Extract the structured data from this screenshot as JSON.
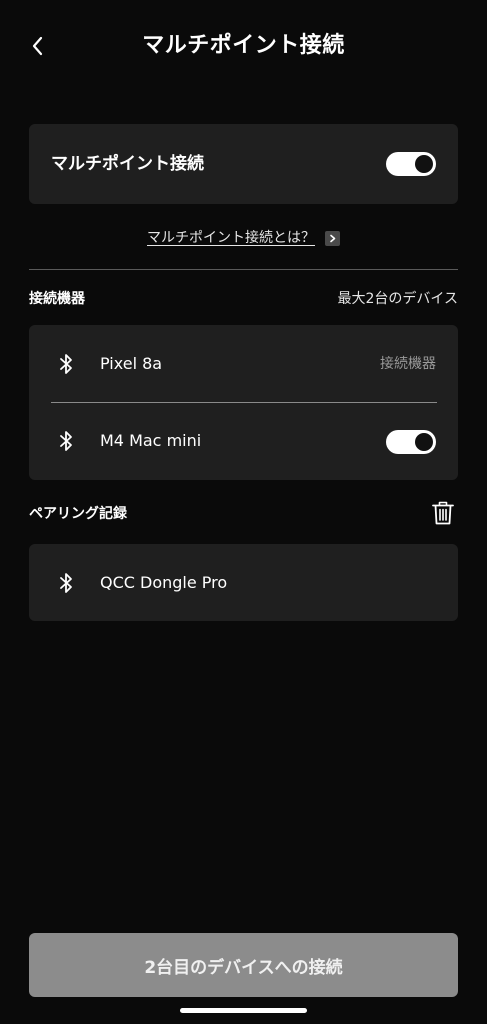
{
  "header": {
    "title": "マルチポイント接続",
    "back_icon": "chevron-left-icon"
  },
  "multipoint": {
    "label": "マルチポイント接続",
    "enabled": true
  },
  "help": {
    "link_text": "マルチポイント接続とは？",
    "arrow_icon": "chevron-right-icon"
  },
  "connected": {
    "title": "接続機器",
    "note": "最大2台のデバイス",
    "devices": [
      {
        "name": "Pixel 8a",
        "status": "接続機器",
        "icon": "bluetooth-icon"
      },
      {
        "name": "M4 Mac mini",
        "enabled": true,
        "icon": "bluetooth-icon"
      }
    ]
  },
  "history": {
    "title": "ペアリング記録",
    "delete_icon": "trash-icon",
    "devices": [
      {
        "name": "QCC Dongle Pro",
        "icon": "bluetooth-icon"
      }
    ]
  },
  "footer": {
    "connect_button": "2台目のデバイスへの接続"
  },
  "colors": {
    "background": "#0a0a0a",
    "card": "#1f1f1f",
    "button_disabled": "#8c8c8c",
    "secondary_text": "#9a9a9a"
  }
}
